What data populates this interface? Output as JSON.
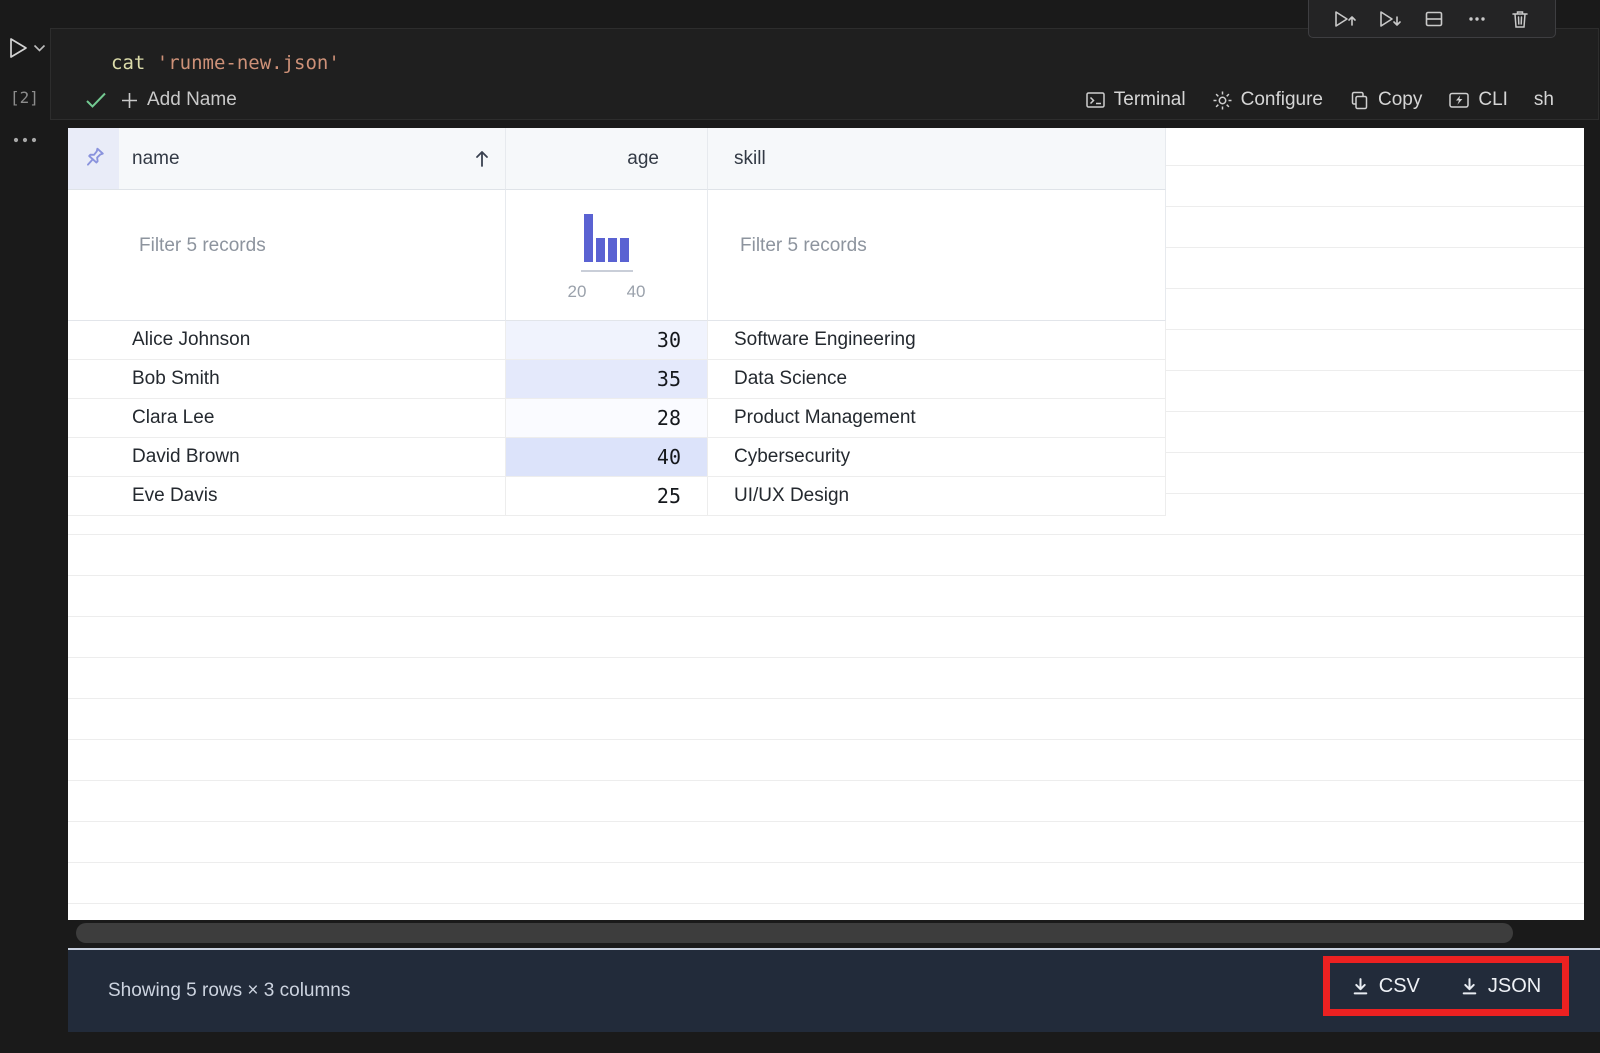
{
  "cell": {
    "code": {
      "command": "cat",
      "argument": "'runme-new.json'"
    },
    "execution_count": "[2]",
    "toolbar_icons": [
      {
        "name": "execute-cell-and-above"
      },
      {
        "name": "execute-cell-and-below"
      },
      {
        "name": "split-cell"
      },
      {
        "name": "more-actions"
      },
      {
        "name": "delete-cell"
      }
    ],
    "add_name_label": "Add Name",
    "actions": [
      {
        "icon": "terminal-icon",
        "label": "Terminal"
      },
      {
        "icon": "gear-icon",
        "label": "Configure"
      },
      {
        "icon": "copy-icon",
        "label": "Copy"
      },
      {
        "icon": "cli-icon",
        "label": "CLI"
      }
    ],
    "language_label": "sh"
  },
  "table": {
    "columns": [
      {
        "label": "name",
        "sorted": "ascending"
      },
      {
        "label": "age",
        "align": "right"
      },
      {
        "label": "skill"
      }
    ],
    "filters": {
      "name_placeholder": "Filter 5 records",
      "skill_placeholder": "Filter 5 records"
    },
    "age_histogram": {
      "bar_counts": [
        2,
        1,
        1,
        1
      ],
      "ticks": [
        "20",
        "40"
      ],
      "bar_color": "#5a62d2"
    },
    "rows": [
      {
        "name": "Alice Johnson",
        "age": "30",
        "skill": "Software Engineering",
        "age_cell_color": "#f0f3fd"
      },
      {
        "name": "Bob Smith",
        "age": "35",
        "skill": "Data Science",
        "age_cell_color": "#e4e9fb"
      },
      {
        "name": "Clara Lee",
        "age": "28",
        "skill": "Product Management",
        "age_cell_color": "#fafbff"
      },
      {
        "name": "David Brown",
        "age": "40",
        "skill": "Cybersecurity",
        "age_cell_color": "#dce3fa"
      },
      {
        "name": "Eve Davis",
        "age": "25",
        "skill": "UI/UX Design",
        "age_cell_color": "#ffffff"
      }
    ]
  },
  "status_bar": {
    "summary": "Showing 5 rows × 3 columns",
    "export_buttons": [
      {
        "icon": "download-icon",
        "label": "CSV"
      },
      {
        "icon": "download-icon",
        "label": "JSON"
      }
    ]
  },
  "annotation": {
    "type": "highlight-box",
    "color": "#ec2121"
  },
  "colors": {
    "accent_indigo": "#5a62d2",
    "status_bar_bg": "#222b3a",
    "header_bg": "#f6f8fa",
    "pin_cell_bg": "#e9ecf8",
    "code_command": "#dcdcaa",
    "code_string": "#ce9178",
    "success_green": "#73c991"
  }
}
